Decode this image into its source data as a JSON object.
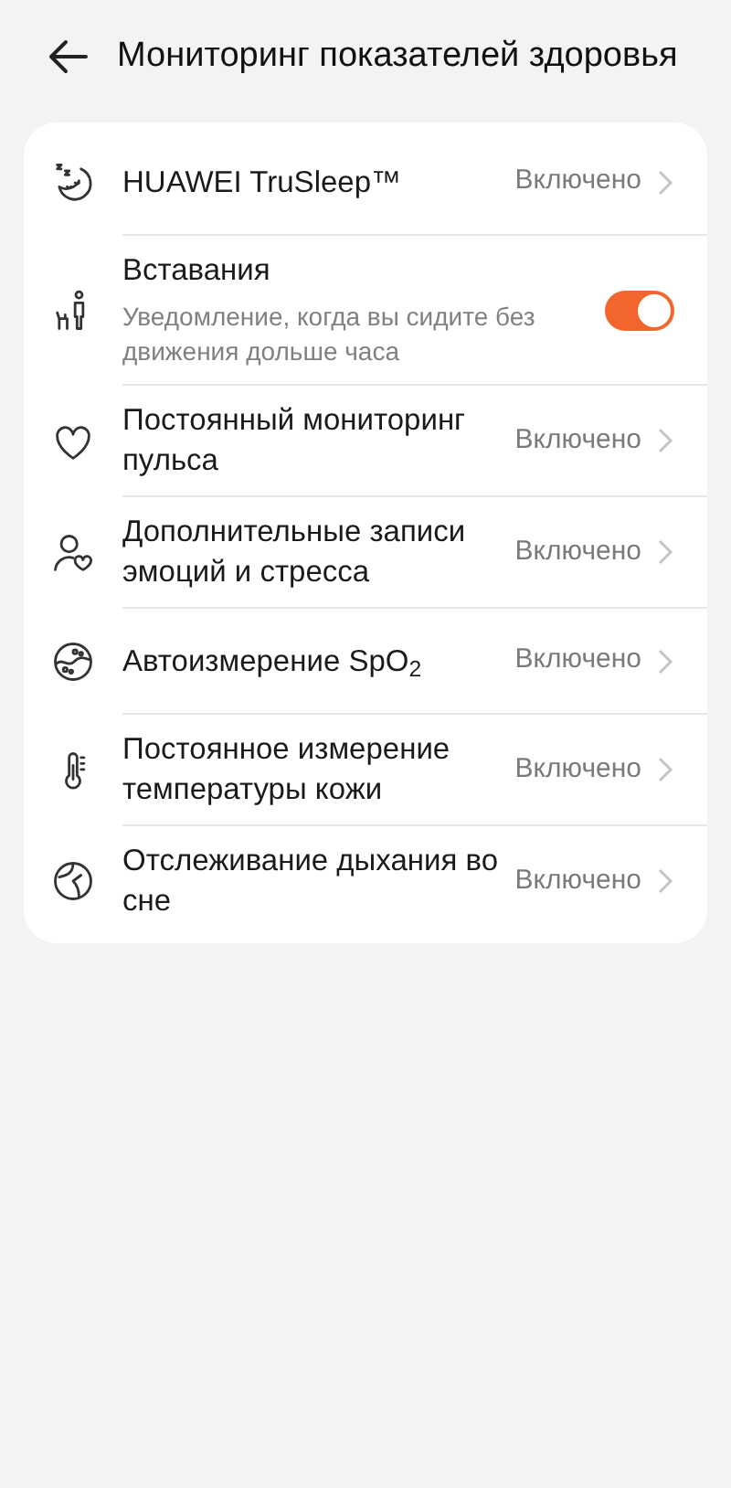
{
  "header": {
    "title": "Мониторинг показателей здоровья"
  },
  "items": [
    {
      "kind": "link",
      "title": "HUAWEI TruSleep™",
      "value": "Включено"
    },
    {
      "kind": "toggle",
      "title": "Вставания",
      "subtitle": "Уведомление, когда вы сидите без движения дольше часа",
      "on": true
    },
    {
      "kind": "link",
      "title": "Постоянный мониторинг пульса",
      "value": "Включено"
    },
    {
      "kind": "link",
      "title": "Дополнительные записи эмоций и стресса",
      "value": "Включено"
    },
    {
      "kind": "link",
      "title": "Автоизмерение SpO$_{2}$",
      "value": "Включено"
    },
    {
      "kind": "link",
      "title": "Постоянное измерение температуры кожи",
      "value": "Включено"
    },
    {
      "kind": "link",
      "title": "Отслеживание дыхания во сне",
      "value": "Включено"
    }
  ]
}
